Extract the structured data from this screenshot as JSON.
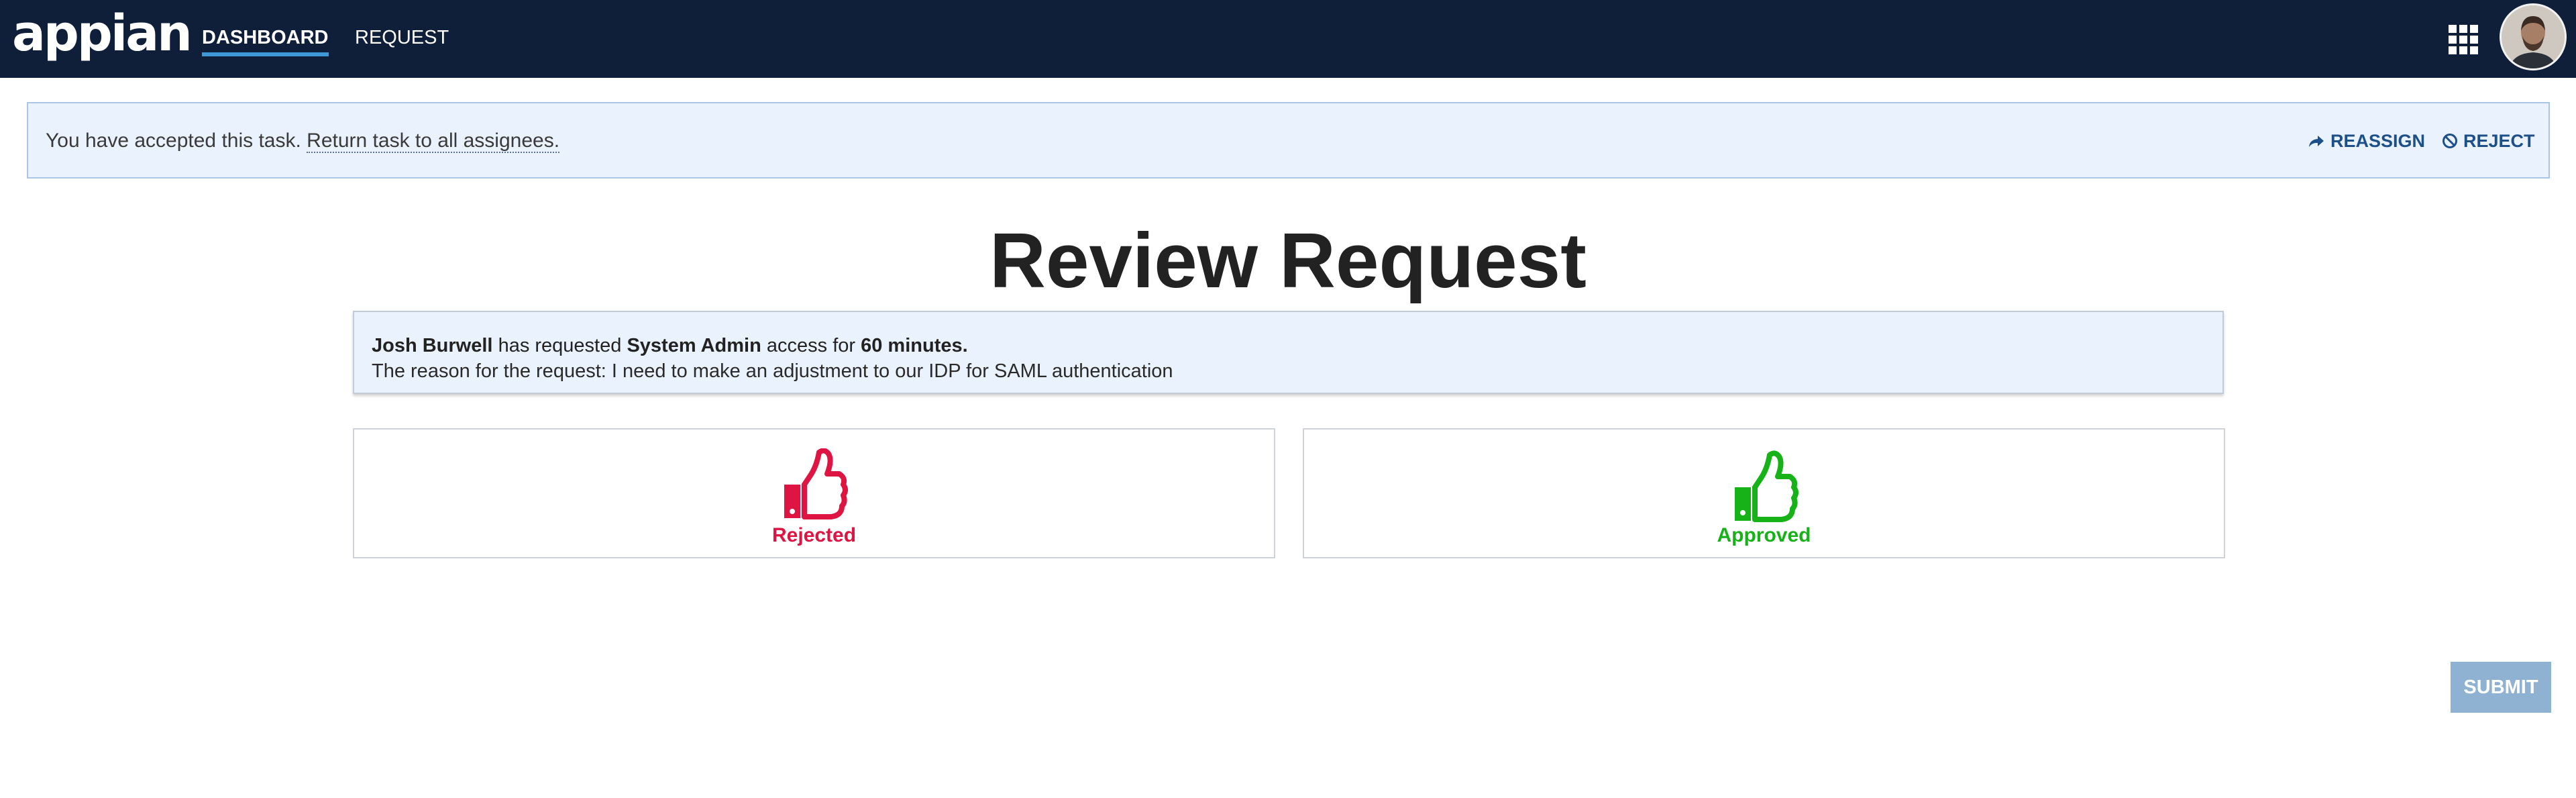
{
  "header": {
    "logo_text": "appian",
    "nav": [
      {
        "label": "DASHBOARD",
        "active": true
      },
      {
        "label": "REQUEST",
        "active": false
      }
    ],
    "apps_icon": "grid-icon",
    "avatar_icon": "user-avatar"
  },
  "task_banner": {
    "message": "You have accepted this task.",
    "return_link": "Return task to all assignees.",
    "reassign_label": "REASSIGN",
    "reassign_icon": "share-arrow-icon",
    "reject_label": "REJECT",
    "reject_icon": "prohibited-icon"
  },
  "page": {
    "title": "Review Request"
  },
  "request_info": {
    "requester": "Josh Burwell",
    "text_has_requested": "has requested",
    "role": "System Admin",
    "text_access_for": "access for",
    "duration": "60 minutes.",
    "reason_prefix": "The reason for the request:",
    "reason": "I need to make an adjustment to our IDP for SAML authentication"
  },
  "decisions": {
    "reject": {
      "label": "Rejected",
      "icon": "thumbs-down-icon",
      "color": "#de1442"
    },
    "approve": {
      "label": "Approved",
      "icon": "thumbs-up-icon",
      "color": "#17b118"
    }
  },
  "actions": {
    "submit_label": "SUBMIT"
  },
  "colors": {
    "topbar": "#0f1f3a",
    "nav_active_underline": "#3f99d6",
    "banner_bg": "#eaf2fd",
    "link_blue": "#1d4f89",
    "submit_bg": "#8fb2d3"
  }
}
